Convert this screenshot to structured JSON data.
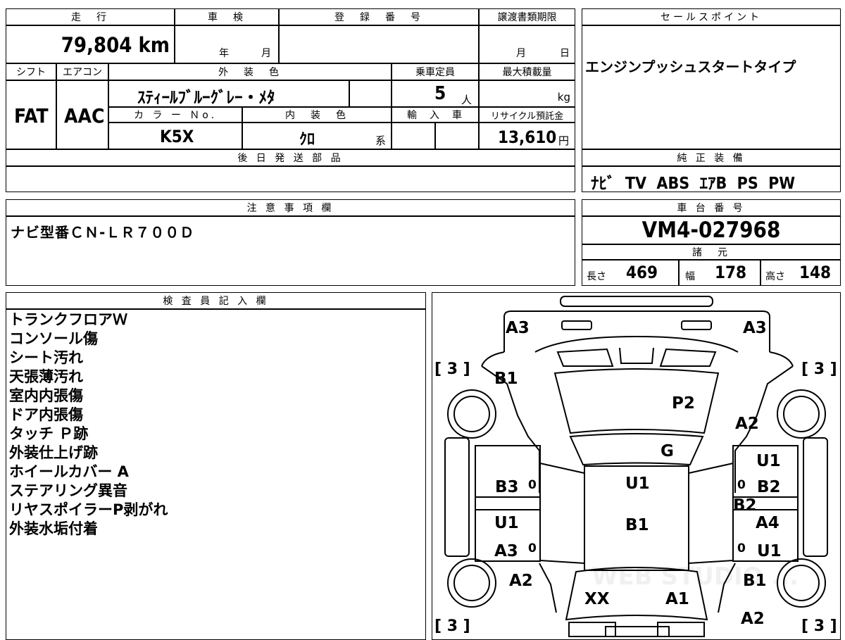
{
  "top": {
    "mileage_label": "走　行",
    "mileage_value": "79,804 km",
    "inspection_label": "車　検",
    "inspection_year": "年",
    "inspection_month": "月",
    "registration_label": "登　録　番　号",
    "transfer_label": "譲渡書類期限",
    "transfer_month": "月",
    "transfer_day": "日",
    "shift_label": "シフト",
    "shift_value": "FAT",
    "aircon_label": "エアコン",
    "aircon_value": "AAC",
    "ext_color_label": "外　装　色",
    "ext_color_value": "ｽﾃｨｰﾙﾌﾞﾙｰｸﾞﾚｰ・ﾒﾀ",
    "capacity_label": "乗車定員",
    "capacity_value": "5",
    "capacity_unit": "人",
    "maxload_label": "最大積載量",
    "maxload_unit": "kg",
    "color_no_label": "カ ラ ー Ｎo.",
    "color_no_value": "K5X",
    "int_color_label": "内　装　色",
    "int_color_value": "ｸﾛ",
    "int_color_suffix": "系",
    "import_label": "輸　入　車",
    "recycle_label": "リサイクル預託金",
    "recycle_value": "13,610",
    "recycle_unit": "円",
    "later_parts_label": "後 日 発 送 部 品"
  },
  "sales": {
    "label": "セールスポイント",
    "value": "エンジンプッシュスタートタイプ"
  },
  "equipment": {
    "label": "純 正 装 備",
    "value": "ﾅﾋﾞ  TV  ABS  ｴｱB  PS  PW"
  },
  "notes": {
    "label": "注 意 事 項 欄",
    "value": "ナビ型番ＣＮ-ＬＲ７００Ｄ"
  },
  "chassis": {
    "label": "車 台 番 号",
    "value": "VM4-027968"
  },
  "specs": {
    "label": "諸　元",
    "length_label": "長さ",
    "length_value": "469",
    "width_label": "幅",
    "width_value": "178",
    "height_label": "高さ",
    "height_value": "148"
  },
  "inspector": {
    "label": "検 査 員 記 入 欄",
    "lines": [
      "トランクフロアＷ",
      "コンソール傷",
      "シート汚れ",
      "天張薄汚れ",
      "室内内張傷",
      "ドア内張傷",
      "タッチ Ｐ跡",
      "外装仕上げ跡",
      "ホイールカバー A",
      "ステアリング異音",
      "リヤスポイラーP剥がれ",
      "外装水垢付着"
    ]
  },
  "diagram": {
    "tire_codes": [
      "[ 3 ]",
      "[ 3 ]",
      "[ 3 ]",
      "[ 3 ]"
    ],
    "zero_marks": [
      "0",
      "0",
      "0",
      "0"
    ],
    "marks": [
      {
        "text": "A3"
      },
      {
        "text": "A3"
      },
      {
        "text": "B1"
      },
      {
        "text": "P2"
      },
      {
        "text": "A2"
      },
      {
        "text": "G"
      },
      {
        "text": "U1"
      },
      {
        "text": "U1"
      },
      {
        "text": "B3"
      },
      {
        "text": "B2"
      },
      {
        "text": "B2"
      },
      {
        "text": "U1"
      },
      {
        "text": "B1"
      },
      {
        "text": "A4"
      },
      {
        "text": "A3"
      },
      {
        "text": "U1"
      },
      {
        "text": "A2"
      },
      {
        "text": "B1"
      },
      {
        "text": "XX"
      },
      {
        "text": "A1"
      },
      {
        "text": "A2"
      }
    ],
    "watermark": "WEB STUDIO ..."
  }
}
